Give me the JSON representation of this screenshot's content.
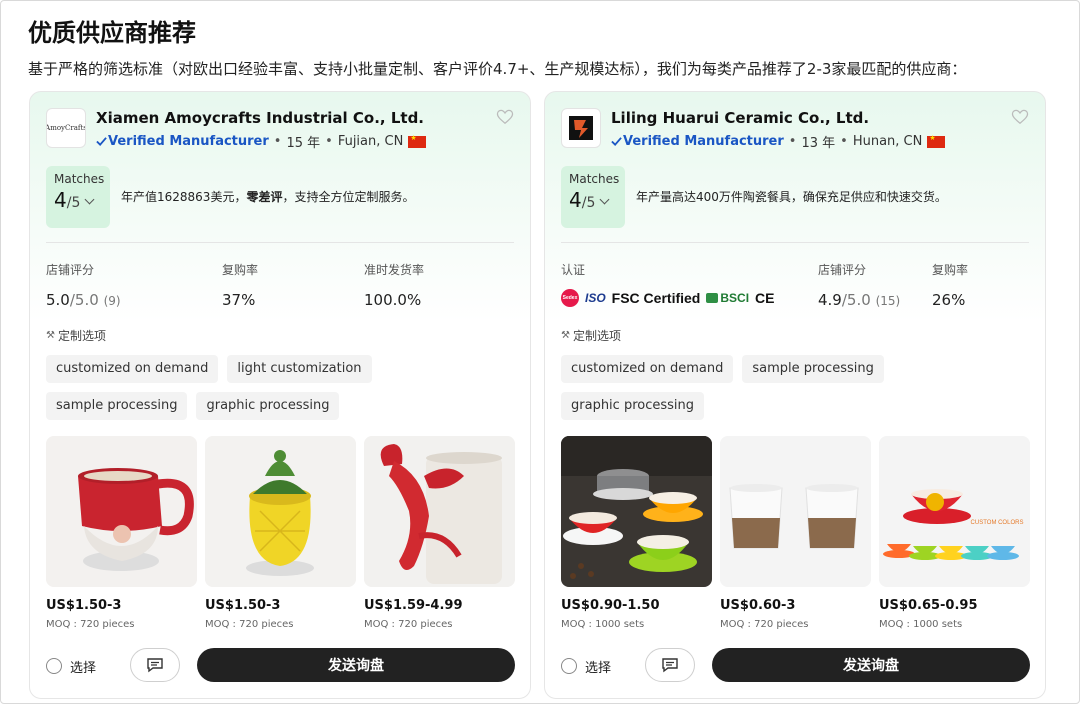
{
  "page": {
    "title": "优质供应商推荐",
    "subtitle": "基于严格的筛选标准（对欧出口经验丰富、支持小批量定制、客户评价4.7+、生产规模达标），我们为每类产品推荐了2-3家最匹配的供应商："
  },
  "common": {
    "verified_label": "Verified Manufacturer",
    "matches_label": "Matches",
    "matches_denominator": "/5",
    "customization_title": "定制选项",
    "select_label": "选择",
    "send_inquiry_label": "发送询盘"
  },
  "suppliers": [
    {
      "logo_text": "AmoyCrafts",
      "name": "Xiamen Amoycrafts Industrial Co., Ltd.",
      "years": "15 年",
      "location": "Fujian, CN",
      "matches": "4",
      "highlight_pre": "年产值1628863美元，",
      "highlight_bold": "零差评",
      "highlight_post": "，支持全方位定制服务。",
      "stats": [
        {
          "label": "店铺评分",
          "value": "5.0",
          "den": "/5.0",
          "count": "(9)"
        },
        {
          "label": "复购率",
          "value": "37%"
        },
        {
          "label": "准时发货率",
          "value": "100.0%"
        }
      ],
      "tags": [
        "customized on demand",
        "light customization",
        "sample processing",
        "graphic processing"
      ],
      "products": [
        {
          "price": "US$1.50-3",
          "moq": "MOQ : 720 pieces"
        },
        {
          "price": "US$1.50-3",
          "moq": "MOQ : 720 pieces"
        },
        {
          "price": "US$1.59-4.99",
          "moq": "MOQ : 720 pieces"
        }
      ]
    },
    {
      "name": "Liling Huarui Ceramic Co., Ltd.",
      "years": "13 年",
      "location": "Hunan, CN",
      "matches": "4",
      "highlight": "年产量高达400万件陶瓷餐具，确保充足供应和快速交货。",
      "cert_label": "认证",
      "certs": {
        "sedex": "Sedex",
        "iso": "ISO",
        "fsc": "FSC Certified",
        "bsci": "BSCI",
        "ce": "CE"
      },
      "stats": [
        {
          "label": "店铺评分",
          "value": "4.9",
          "den": "/5.0",
          "count": "(15)"
        },
        {
          "label": "复购率",
          "value": "26%"
        }
      ],
      "tags": [
        "customized on demand",
        "sample processing",
        "graphic processing"
      ],
      "products": [
        {
          "price": "US$0.90-1.50",
          "moq": "MOQ : 1000 sets"
        },
        {
          "price": "US$0.60-3",
          "moq": "MOQ : 720 pieces"
        },
        {
          "price": "US$0.65-0.95",
          "moq": "MOQ : 1000 sets",
          "image_caption": "CUSTOM COLORS"
        }
      ]
    }
  ],
  "colors": {
    "card_gradient": "#e7f8ee",
    "matches_bg": "#d6f3e0",
    "verified_blue": "#1a56c4",
    "button_dark": "#222222"
  }
}
